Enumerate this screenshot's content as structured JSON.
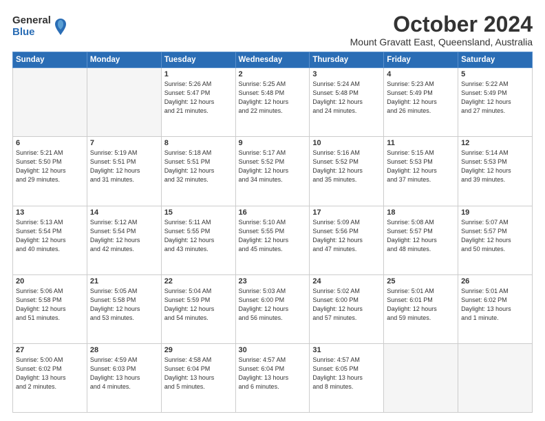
{
  "logo": {
    "general": "General",
    "blue": "Blue"
  },
  "title": {
    "month": "October 2024",
    "location": "Mount Gravatt East, Queensland, Australia"
  },
  "weekdays": [
    "Sunday",
    "Monday",
    "Tuesday",
    "Wednesday",
    "Thursday",
    "Friday",
    "Saturday"
  ],
  "weeks": [
    [
      {
        "day": "",
        "detail": ""
      },
      {
        "day": "",
        "detail": ""
      },
      {
        "day": "1",
        "detail": "Sunrise: 5:26 AM\nSunset: 5:47 PM\nDaylight: 12 hours\nand 21 minutes."
      },
      {
        "day": "2",
        "detail": "Sunrise: 5:25 AM\nSunset: 5:48 PM\nDaylight: 12 hours\nand 22 minutes."
      },
      {
        "day": "3",
        "detail": "Sunrise: 5:24 AM\nSunset: 5:48 PM\nDaylight: 12 hours\nand 24 minutes."
      },
      {
        "day": "4",
        "detail": "Sunrise: 5:23 AM\nSunset: 5:49 PM\nDaylight: 12 hours\nand 26 minutes."
      },
      {
        "day": "5",
        "detail": "Sunrise: 5:22 AM\nSunset: 5:49 PM\nDaylight: 12 hours\nand 27 minutes."
      }
    ],
    [
      {
        "day": "6",
        "detail": "Sunrise: 5:21 AM\nSunset: 5:50 PM\nDaylight: 12 hours\nand 29 minutes."
      },
      {
        "day": "7",
        "detail": "Sunrise: 5:19 AM\nSunset: 5:51 PM\nDaylight: 12 hours\nand 31 minutes."
      },
      {
        "day": "8",
        "detail": "Sunrise: 5:18 AM\nSunset: 5:51 PM\nDaylight: 12 hours\nand 32 minutes."
      },
      {
        "day": "9",
        "detail": "Sunrise: 5:17 AM\nSunset: 5:52 PM\nDaylight: 12 hours\nand 34 minutes."
      },
      {
        "day": "10",
        "detail": "Sunrise: 5:16 AM\nSunset: 5:52 PM\nDaylight: 12 hours\nand 35 minutes."
      },
      {
        "day": "11",
        "detail": "Sunrise: 5:15 AM\nSunset: 5:53 PM\nDaylight: 12 hours\nand 37 minutes."
      },
      {
        "day": "12",
        "detail": "Sunrise: 5:14 AM\nSunset: 5:53 PM\nDaylight: 12 hours\nand 39 minutes."
      }
    ],
    [
      {
        "day": "13",
        "detail": "Sunrise: 5:13 AM\nSunset: 5:54 PM\nDaylight: 12 hours\nand 40 minutes."
      },
      {
        "day": "14",
        "detail": "Sunrise: 5:12 AM\nSunset: 5:54 PM\nDaylight: 12 hours\nand 42 minutes."
      },
      {
        "day": "15",
        "detail": "Sunrise: 5:11 AM\nSunset: 5:55 PM\nDaylight: 12 hours\nand 43 minutes."
      },
      {
        "day": "16",
        "detail": "Sunrise: 5:10 AM\nSunset: 5:55 PM\nDaylight: 12 hours\nand 45 minutes."
      },
      {
        "day": "17",
        "detail": "Sunrise: 5:09 AM\nSunset: 5:56 PM\nDaylight: 12 hours\nand 47 minutes."
      },
      {
        "day": "18",
        "detail": "Sunrise: 5:08 AM\nSunset: 5:57 PM\nDaylight: 12 hours\nand 48 minutes."
      },
      {
        "day": "19",
        "detail": "Sunrise: 5:07 AM\nSunset: 5:57 PM\nDaylight: 12 hours\nand 50 minutes."
      }
    ],
    [
      {
        "day": "20",
        "detail": "Sunrise: 5:06 AM\nSunset: 5:58 PM\nDaylight: 12 hours\nand 51 minutes."
      },
      {
        "day": "21",
        "detail": "Sunrise: 5:05 AM\nSunset: 5:58 PM\nDaylight: 12 hours\nand 53 minutes."
      },
      {
        "day": "22",
        "detail": "Sunrise: 5:04 AM\nSunset: 5:59 PM\nDaylight: 12 hours\nand 54 minutes."
      },
      {
        "day": "23",
        "detail": "Sunrise: 5:03 AM\nSunset: 6:00 PM\nDaylight: 12 hours\nand 56 minutes."
      },
      {
        "day": "24",
        "detail": "Sunrise: 5:02 AM\nSunset: 6:00 PM\nDaylight: 12 hours\nand 57 minutes."
      },
      {
        "day": "25",
        "detail": "Sunrise: 5:01 AM\nSunset: 6:01 PM\nDaylight: 12 hours\nand 59 minutes."
      },
      {
        "day": "26",
        "detail": "Sunrise: 5:01 AM\nSunset: 6:02 PM\nDaylight: 13 hours\nand 1 minute."
      }
    ],
    [
      {
        "day": "27",
        "detail": "Sunrise: 5:00 AM\nSunset: 6:02 PM\nDaylight: 13 hours\nand 2 minutes."
      },
      {
        "day": "28",
        "detail": "Sunrise: 4:59 AM\nSunset: 6:03 PM\nDaylight: 13 hours\nand 4 minutes."
      },
      {
        "day": "29",
        "detail": "Sunrise: 4:58 AM\nSunset: 6:04 PM\nDaylight: 13 hours\nand 5 minutes."
      },
      {
        "day": "30",
        "detail": "Sunrise: 4:57 AM\nSunset: 6:04 PM\nDaylight: 13 hours\nand 6 minutes."
      },
      {
        "day": "31",
        "detail": "Sunrise: 4:57 AM\nSunset: 6:05 PM\nDaylight: 13 hours\nand 8 minutes."
      },
      {
        "day": "",
        "detail": ""
      },
      {
        "day": "",
        "detail": ""
      }
    ]
  ]
}
